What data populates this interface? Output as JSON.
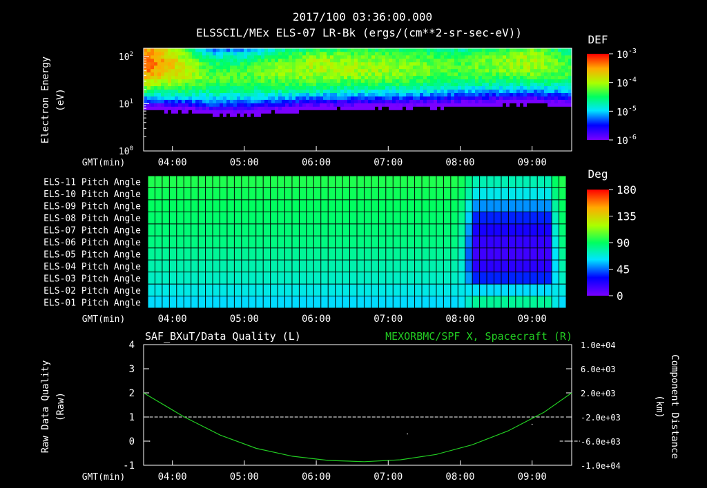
{
  "header": {
    "timestamp": "2017/100 03:36:00.000",
    "title": "ELSSCIL/MEx ELS-07 LR-Bk  (ergs/(cm**2-sr-sec-eV))"
  },
  "time_axis": {
    "label": "GMT(min)",
    "ticks": [
      "04:00",
      "05:00",
      "06:00",
      "07:00",
      "08:00",
      "09:00"
    ],
    "range_min": [
      216,
      573
    ]
  },
  "chart_data": [
    {
      "type": "heatmap",
      "title": "ELSSCIL/MEx ELS-07 LR-Bk  (ergs/(cm**2-sr-sec-eV))",
      "ylabel": "Electron Energy",
      "yunit": "(eV)",
      "yscale": "log",
      "ylim": [
        1,
        150
      ],
      "y_ticks": [
        "10^0",
        "10^1",
        "10^2"
      ],
      "colorbar": {
        "label": "DEF",
        "scale": "log",
        "range": [
          1e-06,
          0.001
        ],
        "ticks": [
          "10^-3",
          "10^-4",
          "10^-5",
          "10^-6"
        ]
      },
      "profile_by_hour": [
        {
          "t": "03:40",
          "peak_energy_ev": 80,
          "max_def": 0.0005
        },
        {
          "t": "04:30",
          "peak_energy_ev": 40,
          "max_def": 5e-05
        },
        {
          "t": "05:00",
          "peak_energy_ev": 40,
          "max_def": 5e-05
        },
        {
          "t": "06:00",
          "peak_energy_ev": 60,
          "max_def": 0.0001
        },
        {
          "t": "07:00",
          "peak_energy_ev": 60,
          "max_def": 8e-05
        },
        {
          "t": "08:00",
          "peak_energy_ev": 60,
          "max_def": 5e-05
        },
        {
          "t": "09:00",
          "peak_energy_ev": 80,
          "max_def": 0.0001
        },
        {
          "t": "09:30",
          "peak_energy_ev": 60,
          "max_def": 5e-05
        }
      ]
    },
    {
      "type": "heatmap",
      "rows": [
        "ELS-11 Pitch Angle",
        "ELS-10 Pitch Angle",
        "ELS-09 Pitch Angle",
        "ELS-08 Pitch Angle",
        "ELS-07 Pitch Angle",
        "ELS-06 Pitch Angle",
        "ELS-05 Pitch Angle",
        "ELS-04 Pitch Angle",
        "ELS-03 Pitch Angle",
        "ELS-02 Pitch Angle",
        "ELS-01 Pitch Angle"
      ],
      "colorbar": {
        "label": "Deg",
        "range": [
          0,
          180
        ],
        "ticks": [
          "180",
          "135",
          "90",
          "45",
          "0"
        ]
      },
      "pitch_angle_before_0800": [
        95,
        92,
        90,
        88,
        86,
        84,
        80,
        76,
        72,
        66,
        60
      ],
      "pitch_angle_0820_0920": [
        75,
        65,
        50,
        35,
        25,
        18,
        15,
        20,
        35,
        60,
        80
      ]
    },
    {
      "type": "line",
      "left_title": "SAF_BXuT/Data Quality (L)",
      "right_title": "MEXORBMC/SPF X, Spacecraft (R)",
      "ylabel_left": "Raw Data Quality",
      "yunit_left": "(Raw)",
      "ylabel_right": "Component Distance",
      "yunit_right": "(km)",
      "ylim_left": [
        -1,
        4
      ],
      "left_ticks": [
        "4",
        "3",
        "2",
        "1",
        "0",
        "-1"
      ],
      "ylim_right": [
        -10000,
        10000
      ],
      "right_ticks": [
        "1.0e+04",
        "6.0e+03",
        "2.0e+03",
        "-2.0e+03",
        "-6.0e+03",
        "-1.0e+04"
      ],
      "series": [
        {
          "name": "SAF_BXuT/Data Quality",
          "color": "#ffffff",
          "segments": [
            {
              "t": [
                221,
                567
              ],
              "value": 1
            },
            {
              "t": [
                563,
                580
              ],
              "value": 0
            }
          ]
        },
        {
          "name": "MEXORBMC/SPF X, Spacecraft",
          "color": "#22cc22",
          "x_min": [
            216,
            250,
            280,
            310,
            340,
            370,
            400,
            430,
            460,
            490,
            520,
            550,
            573
          ],
          "y_km": [
            2000,
            -2000,
            -5000,
            -7200,
            -8500,
            -9200,
            -9400,
            -9100,
            -8200,
            -6600,
            -4300,
            -1200,
            2000
          ]
        }
      ]
    }
  ]
}
